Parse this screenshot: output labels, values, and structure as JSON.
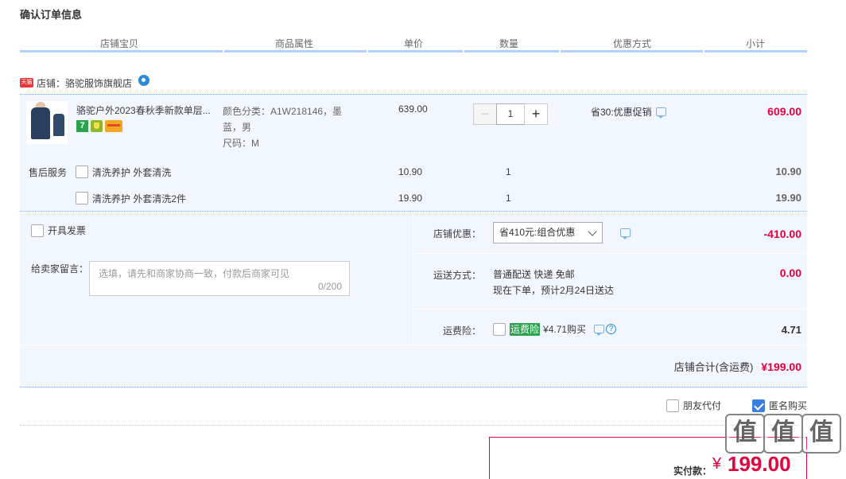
{
  "page_title": "确认订单信息",
  "columns": [
    "店铺宝贝",
    "商品属性",
    "单价",
    "数量",
    "优惠方式",
    "小计"
  ],
  "shop": {
    "badge": "天猫",
    "label": "店铺：骆驼服饰旗舰店"
  },
  "item": {
    "title": "骆驼户外2023春秋季新款单层...",
    "badge_7": "7",
    "attr_line1": "颜色分类：A1W218146，墨",
    "attr_line2": "蓝，男",
    "attr_size": "尺码：M",
    "unit_price": "639.00",
    "quantity": "1",
    "minus": "−",
    "plus": "+",
    "promo": "省30:优惠促销",
    "subtotal": "609.00"
  },
  "service": {
    "label": "售后服务",
    "items": [
      {
        "name": "清洗养护 外套清洗",
        "price": "10.90",
        "qty": "1",
        "subtotal": "10.90"
      },
      {
        "name": "清洗养护 外套清洗2件",
        "price": "19.90",
        "qty": "1",
        "subtotal": "19.90"
      }
    ]
  },
  "order": {
    "invoice_label": "开具发票",
    "note_label": "给卖家留言：",
    "note_placeholder": "选填，请先和商家协商一致，付款后商家可见",
    "note_count": "0/200",
    "shop_discount_label": "店铺优惠：",
    "shop_discount_selected": "省410元:组合优惠",
    "shop_discount_value": "-410.00",
    "shipping_label": "运送方式：",
    "shipping_line1": "普通配送 快递 免邮",
    "shipping_line2": "现在下单，预计2月24日送达",
    "shipping_value": "0.00",
    "insurance_label": "运费险：",
    "insurance_tag": "运费险",
    "insurance_text": "¥4.71购买",
    "insurance_value": "4.71",
    "total_label": "店铺合计(含运费)",
    "total_value": "¥199.00"
  },
  "options": {
    "friend_pay": "朋友代付",
    "anonymous": "匿名购买"
  },
  "payment": {
    "label": "实付款：",
    "currency": "¥",
    "amount": "199.00"
  },
  "watermark": [
    "值",
    "值",
    "值"
  ],
  "colors": {
    "price_red": "#e4003c",
    "accent_blue": "#b2d1ff",
    "panel_bg": "#f2f7ff"
  }
}
